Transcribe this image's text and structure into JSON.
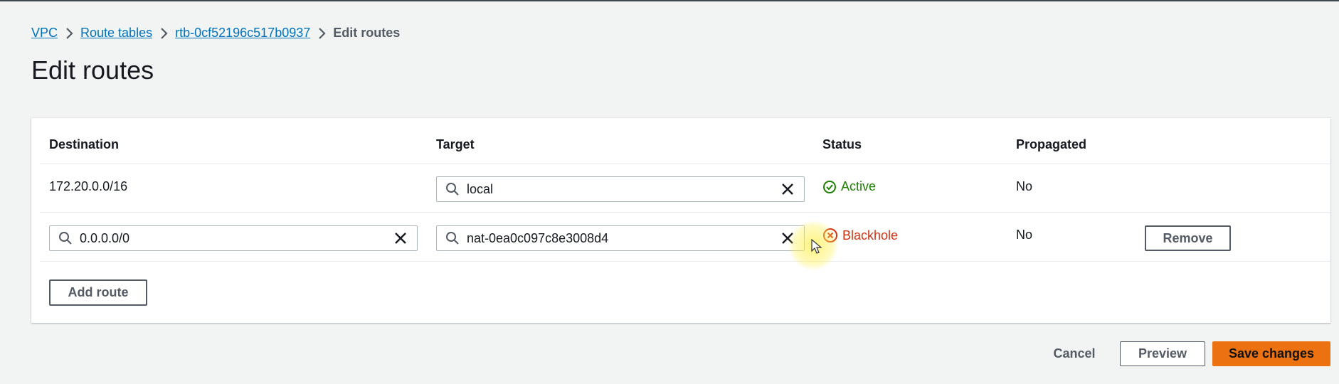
{
  "breadcrumb": {
    "items": [
      "VPC",
      "Route tables",
      "rtb-0cf52196c517b0937"
    ],
    "current": "Edit routes"
  },
  "page": {
    "title": "Edit routes"
  },
  "table": {
    "headers": {
      "destination": "Destination",
      "target": "Target",
      "status": "Status",
      "propagated": "Propagated"
    },
    "rows": [
      {
        "destination": "172.20.0.0/16",
        "target": "local",
        "status": "Active",
        "propagated": "No"
      },
      {
        "destination": "0.0.0.0/0",
        "target": "nat-0ea0c097c8e3008d4",
        "status": "Blackhole",
        "propagated": "No",
        "remove_label": "Remove"
      }
    ],
    "add_route_label": "Add route"
  },
  "footer": {
    "cancel": "Cancel",
    "preview": "Preview",
    "save": "Save changes"
  },
  "colors": {
    "link": "#0073bb",
    "active": "#1d8102",
    "blackhole": "#d13212",
    "primary": "#ec7211"
  },
  "icons": [
    "chevron-right-icon",
    "search-icon",
    "clear-icon",
    "status-active-icon",
    "status-error-icon",
    "cursor-icon"
  ]
}
